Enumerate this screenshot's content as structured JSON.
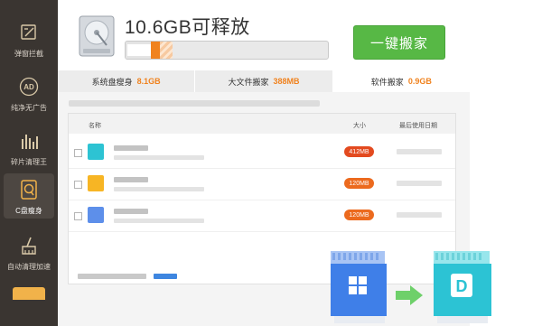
{
  "sidebar": {
    "items": [
      {
        "label": "弹窗拦截",
        "icon": "popup-block-icon"
      },
      {
        "label": "纯净无广告",
        "icon": "ad-free-icon"
      },
      {
        "label": "碎片清理王",
        "icon": "fragment-clean-icon"
      },
      {
        "label": "C盘瘦身",
        "icon": "c-drive-slim-icon",
        "active": true
      },
      {
        "label": "自动清理加速",
        "icon": "auto-clean-icon"
      }
    ],
    "ad_badge_text": "AD"
  },
  "header": {
    "title": "10.6GB可释放",
    "move_button": "一键搬家",
    "usage_bar": {
      "used_fraction": 0.13,
      "orange_fraction": 0.05,
      "movable_fraction": 0.13
    }
  },
  "tabs": [
    {
      "label": "系统盘瘦身",
      "value": "8.1GB"
    },
    {
      "label": "大文件搬家",
      "value": "388MB"
    },
    {
      "label": "软件搬家",
      "value": "0.9GB"
    }
  ],
  "table": {
    "columns": {
      "name": "名称",
      "size": "大小",
      "date": "最后使用日期"
    },
    "rows": [
      {
        "size": "412MB",
        "icon_color": "#2dc3d3",
        "icon": "file-cyan-icon"
      },
      {
        "size": "120MB",
        "icon_color": "#f7b524",
        "icon": "file-yellow-icon"
      },
      {
        "size": "120MB",
        "icon_color": "#5d8fea",
        "icon": "file-blue-icon"
      }
    ]
  },
  "illustration": {
    "source_drive_letter": "",
    "target_drive_letter": "D"
  },
  "colors": {
    "accent_orange": "#f0821e",
    "button_green": "#57b845",
    "sidebar_bg": "#3a3531"
  }
}
